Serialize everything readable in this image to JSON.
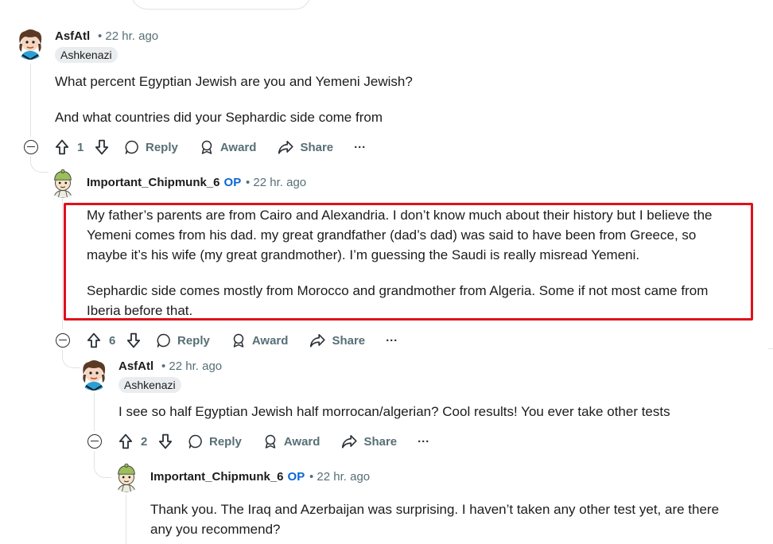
{
  "comments": [
    {
      "username": "AsfAtl",
      "is_op": false,
      "time": "• 22 hr. ago",
      "flair": "Ashkenazi",
      "paragraphs": [
        "What percent Egyptian Jewish are you and Yemeni Jewish?",
        "And what countries did your Sephardic side come from"
      ],
      "votes": "1"
    },
    {
      "username": "Important_Chipmunk_6",
      "is_op": true,
      "op_label": "OP",
      "time": "• 22 hr. ago",
      "paragraphs": [
        "My father’s parents are from Cairo and Alexandria. I don’t know much about their history but I believe the Yemeni comes from his dad. my great grandfather (dad’s dad) was said to have been from Greece, so maybe it’s his wife (my great grandmother). I’m guessing the Saudi is really misread Yemeni.",
        "Sephardic side comes mostly from Morocco and grandmother from Algeria. Some if not most came from Iberia before that."
      ],
      "votes": "6",
      "highlighted": true
    },
    {
      "username": "AsfAtl",
      "is_op": false,
      "time": "• 22 hr. ago",
      "flair": "Ashkenazi",
      "paragraphs": [
        "I see so half Egyptian Jewish half morrocan/algerian? Cool results! You ever take other tests"
      ],
      "votes": "2"
    },
    {
      "username": "Important_Chipmunk_6",
      "is_op": true,
      "op_label": "OP",
      "time": "• 22 hr. ago",
      "paragraphs": [
        "Thank you. The Iraq and Azerbaijan was surprising. I haven’t taken any other test yet, are there any you recommend?"
      ]
    }
  ],
  "actions": {
    "reply": "Reply",
    "award": "Award",
    "share": "Share",
    "more": "···"
  },
  "colors": {
    "highlight_border": "#e0101b",
    "op_badge": "#0a66d6",
    "meta_text": "#576f76",
    "thread_line": "#dfe3e6"
  }
}
